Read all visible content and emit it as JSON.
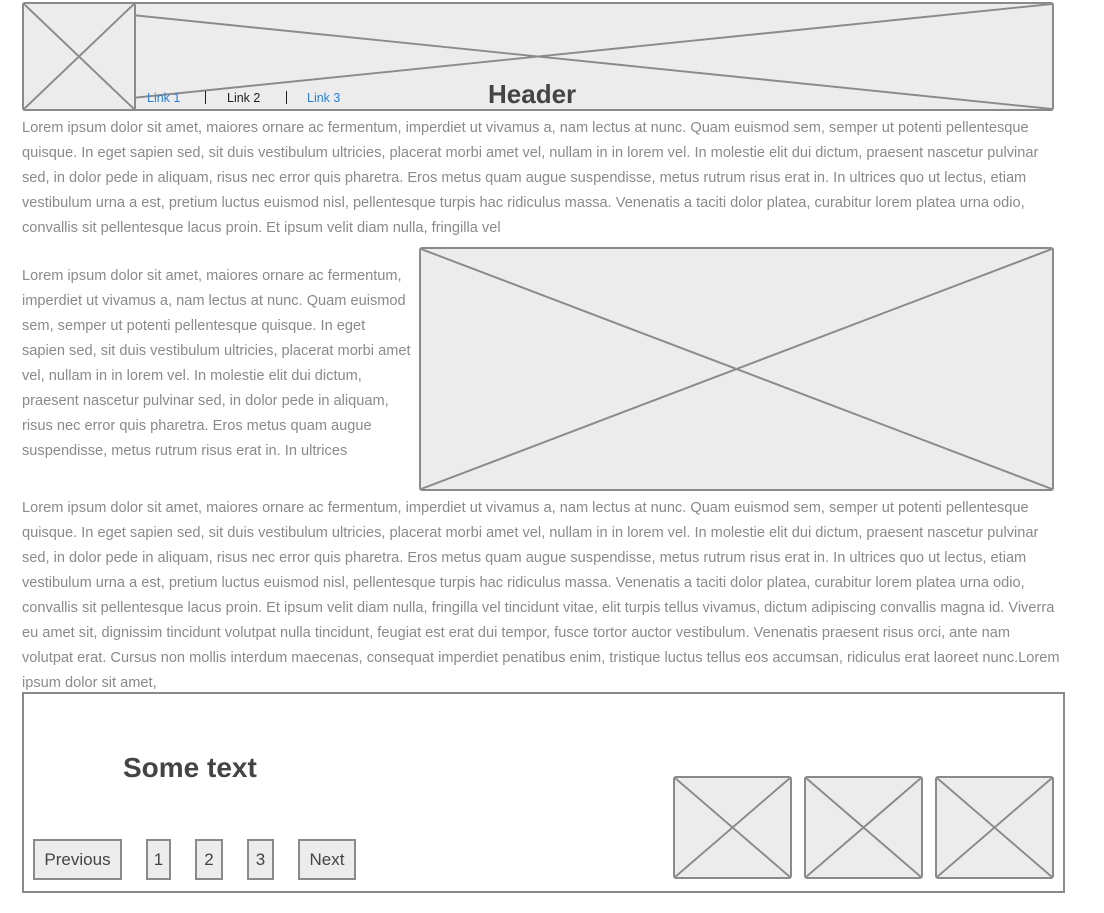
{
  "header": {
    "title": "Header",
    "links": [
      "Link 1",
      "Link 2",
      "Link 3"
    ]
  },
  "paragraphs": {
    "top": "Lorem ipsum dolor sit amet, maiores ornare ac fermentum, imperdiet ut vivamus a, nam lectus at nunc. Quam euismod sem, semper ut potenti pellentesque quisque. In eget sapien sed, sit duis vestibulum ultricies, placerat morbi amet vel, nullam in in lorem vel. In molestie elit dui dictum, praesent nascetur pulvinar sed, in dolor pede in aliquam, risus nec error quis pharetra. Eros metus quam augue suspendisse, metus rutrum risus erat in.  In ultrices quo ut lectus, etiam vestibulum urna a est, pretium luctus euismod nisl, pellentesque turpis hac ridiculus massa. Venenatis a taciti dolor platea, curabitur lorem platea urna odio, convallis sit pellentesque lacus proin. Et ipsum velit diam nulla, fringilla vel",
    "side": "Lorem ipsum dolor sit amet, maiores ornare ac fermentum, imperdiet ut vivamus a, nam lectus at nunc. Quam euismod sem, semper ut potenti pellentesque quisque. In eget sapien sed, sit duis vestibulum ultricies, placerat morbi amet vel, nullam in in lorem vel. In molestie elit dui dictum, praesent nascetur pulvinar sed, in dolor pede in aliquam, risus nec error quis pharetra. Eros metus quam augue suspendisse, metus rutrum risus erat in.  In ultrices",
    "bottom": "Lorem ipsum dolor sit amet, maiores ornare ac fermentum, imperdiet ut vivamus a, nam lectus at nunc. Quam euismod sem, semper ut potenti pellentesque quisque. In eget sapien sed, sit duis vestibulum ultricies, placerat morbi amet vel, nullam in in lorem vel. In molestie elit dui dictum, praesent nascetur pulvinar sed, in dolor pede in aliquam, risus nec error quis pharetra. Eros metus quam augue suspendisse, metus rutrum risus erat in.  In ultrices quo ut lectus, etiam vestibulum urna a est, pretium luctus euismod nisl, pellentesque turpis hac ridiculus massa. Venenatis a taciti dolor platea, curabitur lorem platea urna odio, convallis sit pellentesque lacus proin. Et ipsum velit diam nulla, fringilla vel tincidunt vitae, elit turpis tellus vivamus, dictum adipiscing convallis magna id. Viverra eu amet sit, dignissim tincidunt volutpat nulla tincidunt, feugiat est erat dui tempor, fusce tortor auctor vestibulum. Venenatis praesent risus orci, ante nam volutpat erat. Cursus non mollis interdum maecenas, consequat imperdiet penatibus enim, tristique luctus tellus eos accumsan, ridiculus erat laoreet nunc.Lorem ipsum dolor sit amet,"
  },
  "footer": {
    "heading": "Some text",
    "pagination": {
      "previous": "Previous",
      "pages": [
        "1",
        "2",
        "3"
      ],
      "next": "Next"
    }
  },
  "colors": {
    "link_active": "#2a7fd4",
    "link_current": "#222222",
    "body_text": "#8a8a8a",
    "heading_text": "#444444",
    "placeholder_fill": "#ececec",
    "placeholder_stroke": "#8a8a8a"
  }
}
